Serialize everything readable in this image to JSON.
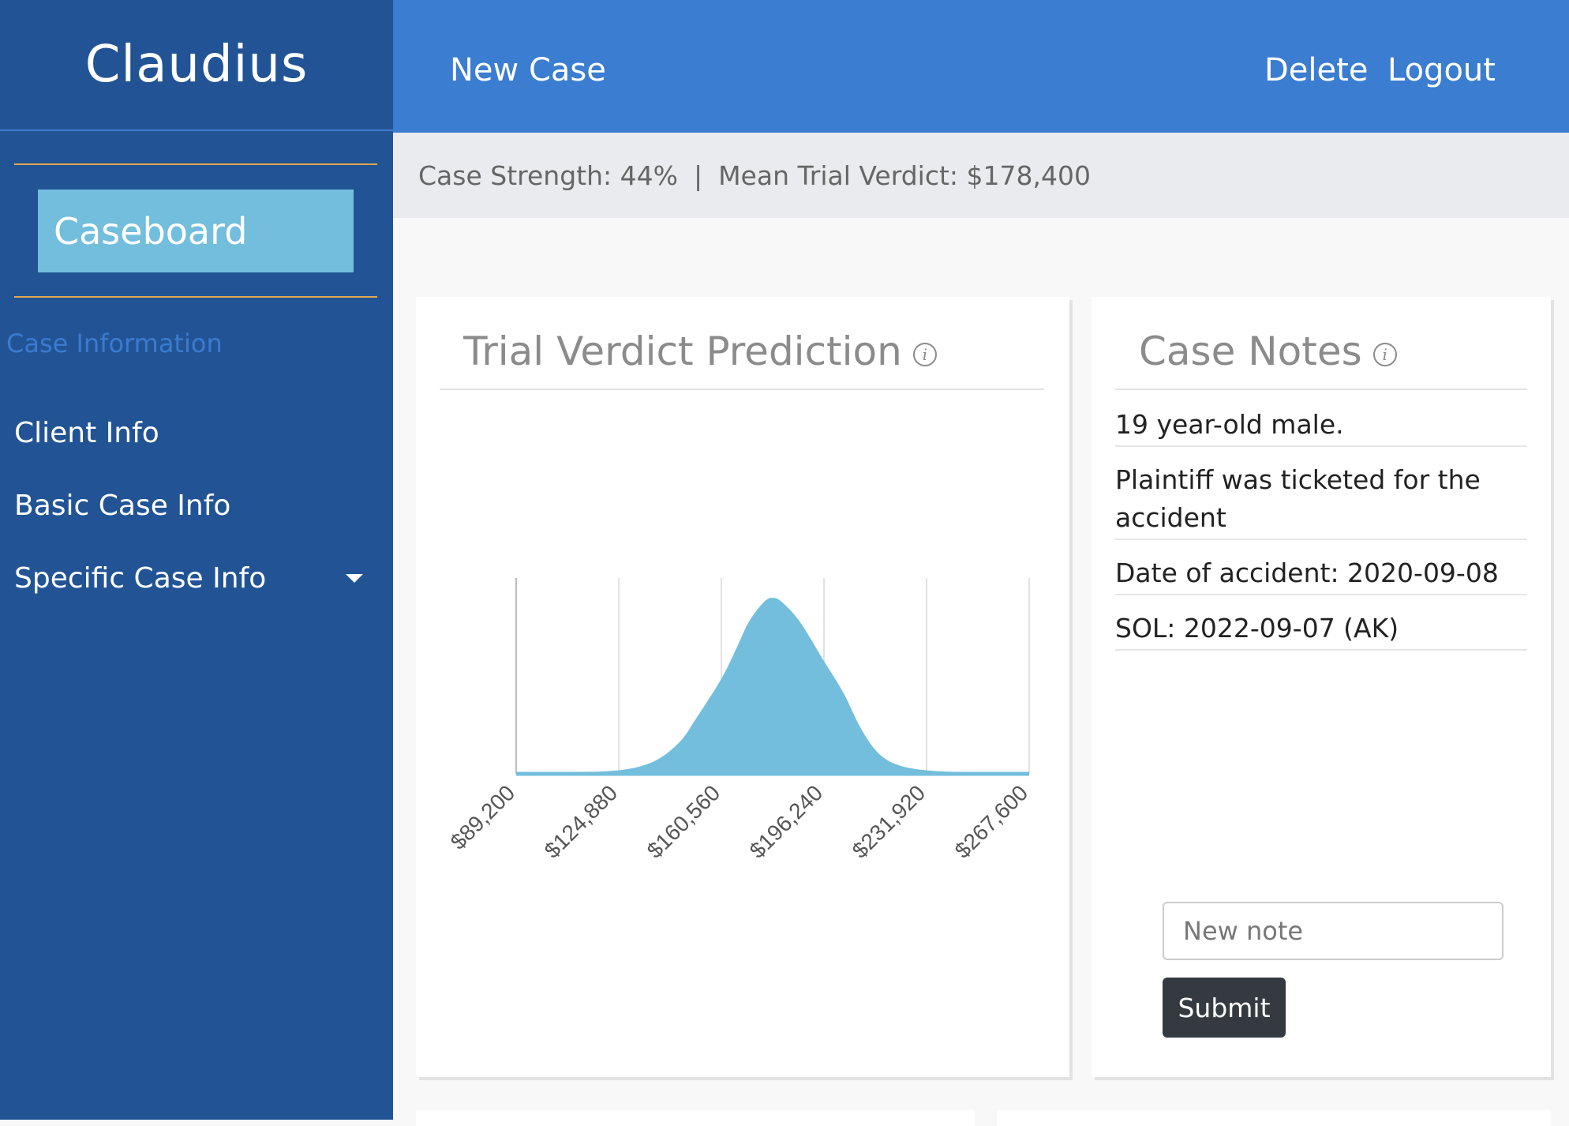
{
  "sidebar": {
    "brand": "Claudius",
    "caseboard_label": "Caseboard",
    "section_title": "Case Information",
    "items": [
      {
        "label": "Client Info"
      },
      {
        "label": "Basic Case Info"
      },
      {
        "label": "Specific Case Info"
      }
    ],
    "icons": {
      "dropdown": "chevron-down-icon"
    }
  },
  "topbar": {
    "new_case": "New Case",
    "delete": "Delete",
    "logout": "Logout"
  },
  "statusbar": {
    "case_strength": "Case Strength: 44%",
    "separator": "|",
    "mean_verdict": "Mean Trial Verdict: $178,400"
  },
  "chart_card": {
    "title": "Trial Verdict Prediction",
    "info_glyph": "i"
  },
  "notes_card": {
    "title": "Case Notes",
    "info_glyph": "i",
    "notes": [
      "19 year-old male.",
      "Plaintiff was ticketed for the accident",
      "Date of accident: 2020-09-08",
      "SOL: 2022-09-07 (AK)"
    ],
    "input_placeholder": "New note",
    "submit_label": "Submit"
  },
  "colors": {
    "sidebar": "#225495",
    "topbar": "#3b7dd0",
    "accent_rule": "#e3a84f",
    "caseboard": "#72bedc",
    "curve_fill": "#72bedc",
    "submit": "#343a40"
  },
  "chart_data": {
    "type": "area",
    "title": "",
    "xlabel": "",
    "ylabel": "",
    "x_ticks": [
      "$89,200",
      "$124,880",
      "$160,560",
      "$196,240",
      "$231,920",
      "$267,600"
    ],
    "xlim": [
      89200,
      267600
    ],
    "grid": true,
    "series": [
      {
        "x": [
          89200,
          106000,
          124880,
          137000,
          146000,
          152000,
          160560,
          166000,
          170000,
          175000,
          178400,
          182000,
          188000,
          196240,
          203000,
          209000,
          215000,
          222000,
          231920,
          245000,
          267600
        ],
        "y": [
          0.01,
          0.01,
          0.02,
          0.07,
          0.18,
          0.32,
          0.54,
          0.72,
          0.86,
          0.97,
          1.0,
          0.97,
          0.86,
          0.64,
          0.46,
          0.26,
          0.12,
          0.05,
          0.02,
          0.01,
          0.01
        ]
      }
    ]
  }
}
